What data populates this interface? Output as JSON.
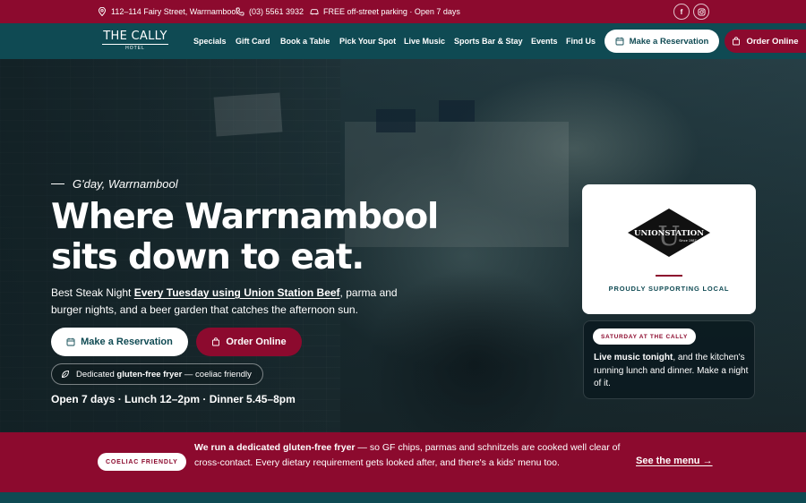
{
  "topbar": {
    "address": "112–114 Fairy Street, Warrnambool",
    "phone": "(03) 5561 3932",
    "parking": "FREE off-street parking · Open 7 days",
    "social": [
      "facebook-icon",
      "instagram-icon"
    ]
  },
  "brand": {
    "name": "THE CALLY",
    "sub": "HOTEL"
  },
  "nav": {
    "links": [
      "Specials",
      "Gift Card",
      "Book a Table",
      "Pick Your Spot",
      "Live Music",
      "Sports Bar & Stay",
      "Events",
      "Find Us"
    ],
    "reserve_label": "Make a Reservation",
    "order_label": "Order Online"
  },
  "hero": {
    "eyebrow": "G'day, Warrnambool",
    "headline_1": "Where Warrnambool",
    "headline_2": "sits down to eat.",
    "lede_before": "Best Steak Night ",
    "lede_strong": "Every Tuesday using Union Station Beef",
    "lede_after": ", parma and burger nights, and a beer garden that catches the afternoon sun.",
    "reserve_label": "Make a Reservation",
    "order_label": "Order Online",
    "gf_before": "Dedicated ",
    "gf_strong": "gluten-free fryer",
    "gf_after": " — coeliac friendly",
    "hours": "Open 7 days · Lunch 12–2pm · Dinner 5.45–8pm"
  },
  "supplier_card": {
    "logo_text": "UNIONSTATION",
    "logo_letter": "U",
    "logo_since": "Since 1987",
    "caption": "PROUDLY SUPPORTING LOCAL"
  },
  "saturday_card": {
    "badge": "SATURDAY AT THE CALLY",
    "strong": "Live music tonight",
    "text": ", and the kitchen's running lunch and dinner. Make a night of it."
  },
  "coeliac": {
    "badge": "COELIAC FRIENDLY",
    "strong": "We run a dedicated gluten-free fryer",
    "text": " — so GF chips, parmas and schnitzels are cooked well clear of cross-contact. Every dietary requirement gets looked after, and there's a kids' menu too.",
    "link": "See the menu →"
  },
  "colors": {
    "crimson": "#8c0a2e",
    "teal": "#0f4a53",
    "white": "#ffffff"
  }
}
